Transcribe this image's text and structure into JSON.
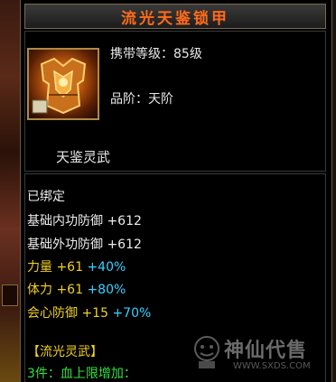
{
  "item": {
    "name": "流光天鉴锁甲",
    "level_label": "携带等级：85级",
    "grade_label": "品阶：天阶",
    "set_label": "天鉴灵武",
    "icon": "golden-armor-icon"
  },
  "stats": {
    "bound": "已绑定",
    "base": [
      {
        "label": "基础内功防御",
        "value": "+612"
      },
      {
        "label": "基础外功防御",
        "value": "+612"
      }
    ],
    "extra": [
      {
        "label": "力量",
        "value": "+61",
        "bonus": "+40%"
      },
      {
        "label": "体力",
        "value": "+61",
        "bonus": "+80%"
      },
      {
        "label": "会心防御",
        "value": "+15",
        "bonus": "+70%"
      }
    ],
    "set_title": "【流光灵武】",
    "set_bonus": "3件：血上限增加："
  },
  "watermark": {
    "text": "神仙代售",
    "url": "WWW.SXDS.COM"
  },
  "colors": {
    "title": "#ff6a1a",
    "yellow": "#f0d020",
    "cyan": "#3ad0ff",
    "green": "#30e040"
  }
}
